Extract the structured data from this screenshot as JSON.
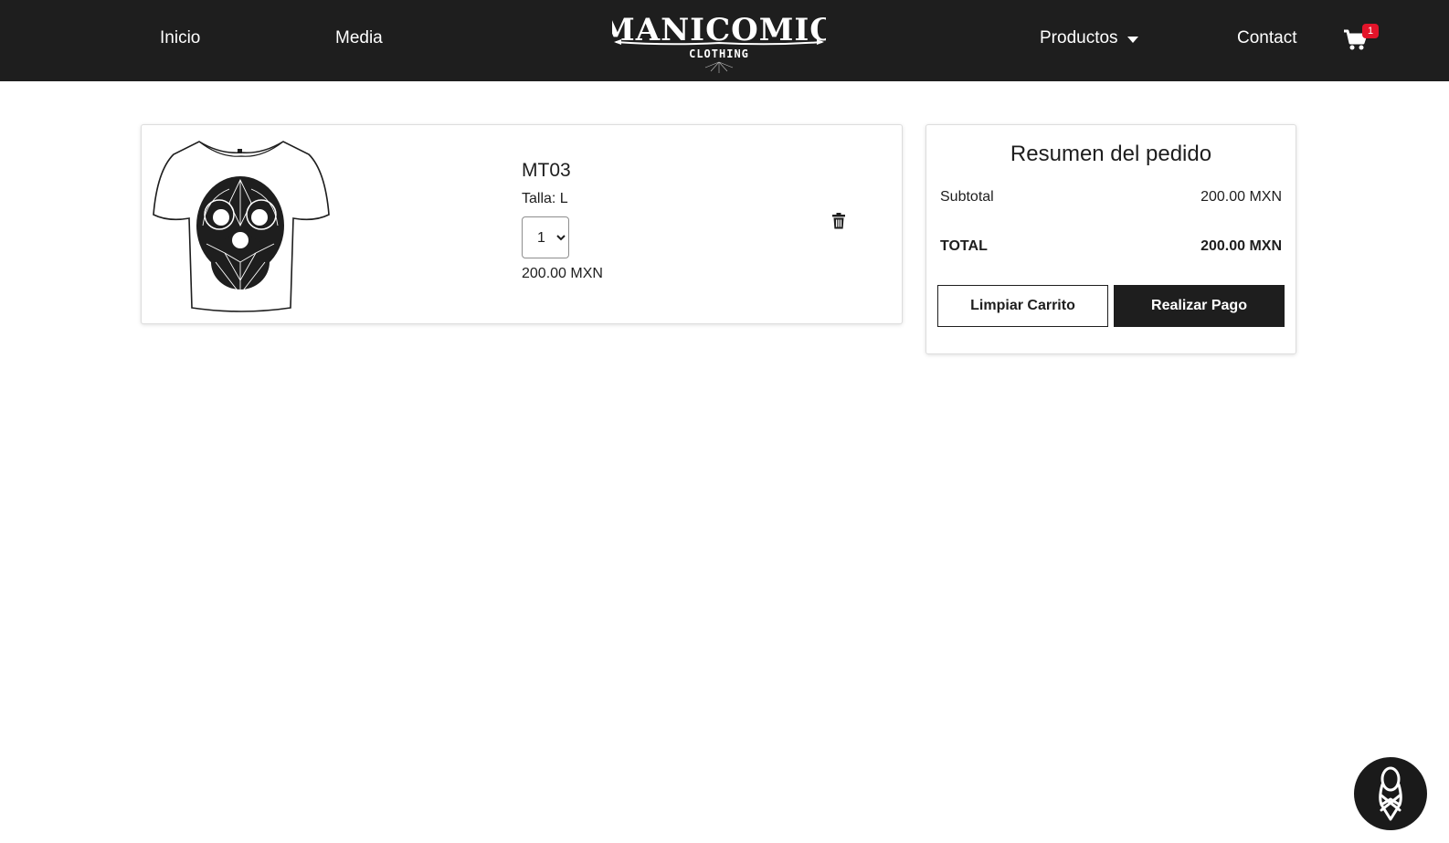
{
  "navbar": {
    "inicio": "Inicio",
    "media": "Media",
    "productos": "Productos",
    "contact": "Contact",
    "logo_text": "MANICOMIO",
    "logo_subtext": "CLOTHING",
    "cart_count": "1"
  },
  "cart_item": {
    "name": "MT03",
    "size": "Talla: L",
    "quantity": "1",
    "price": "200.00 MXN"
  },
  "summary": {
    "title": "Resumen del pedido",
    "subtotal_label": "Subtotal",
    "subtotal_value": "200.00 MXN",
    "total_label": "TOTAL",
    "total_value": "200.00 MXN",
    "clear_button": "Limpiar Carrito",
    "pay_button": "Realizar Pago"
  },
  "colors": {
    "navbar_bg": "#1e1e1e",
    "badge": "#e3142a",
    "pay_button_bg": "#1e1e1e"
  },
  "icons": {
    "cart": "shopping-cart-icon",
    "trash": "trash-icon",
    "caret": "caret-down-icon",
    "widget": "hand-logo-icon"
  }
}
